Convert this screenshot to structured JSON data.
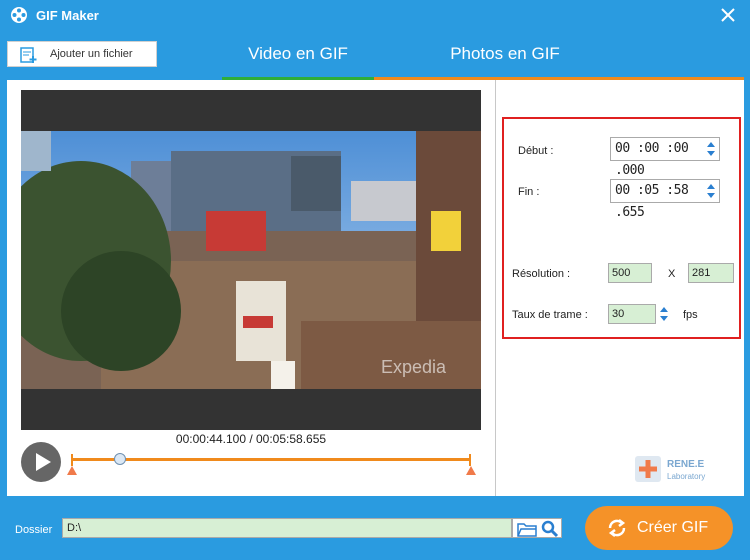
{
  "window": {
    "title": "GIF Maker"
  },
  "toolbar": {
    "add_file_label": "Ajouter un fichier"
  },
  "tabs": [
    {
      "label": "Video en GIF",
      "active": true
    },
    {
      "label": "Photos en GIF",
      "active": false
    }
  ],
  "player": {
    "time_display": "00:00:44.100 / 00:05:58.655",
    "progress_fraction": 0.123
  },
  "video": {
    "watermark": "Expedia"
  },
  "settings": {
    "start_label": "Début :",
    "start_value": "00 :00 :00 .000",
    "end_label": "Fin :",
    "end_value": "00 :05 :58 .655",
    "resolution_label": "Résolution :",
    "width": "500",
    "x_label": "X",
    "height": "281",
    "framerate_label": "Taux de trame :",
    "framerate": "30",
    "fps_label": "fps"
  },
  "brand": {
    "name": "RENE.E",
    "sub": "Laboratory"
  },
  "footer": {
    "folder_label": "Dossier",
    "path_value": "D:\\",
    "create_label": "Créer GIF"
  },
  "colors": {
    "accent_blue": "#2a9be0",
    "orange": "#f08a1c",
    "green_underline": "#2fae3a",
    "highlight_red": "#e02020",
    "field_green": "#d7efd4"
  }
}
